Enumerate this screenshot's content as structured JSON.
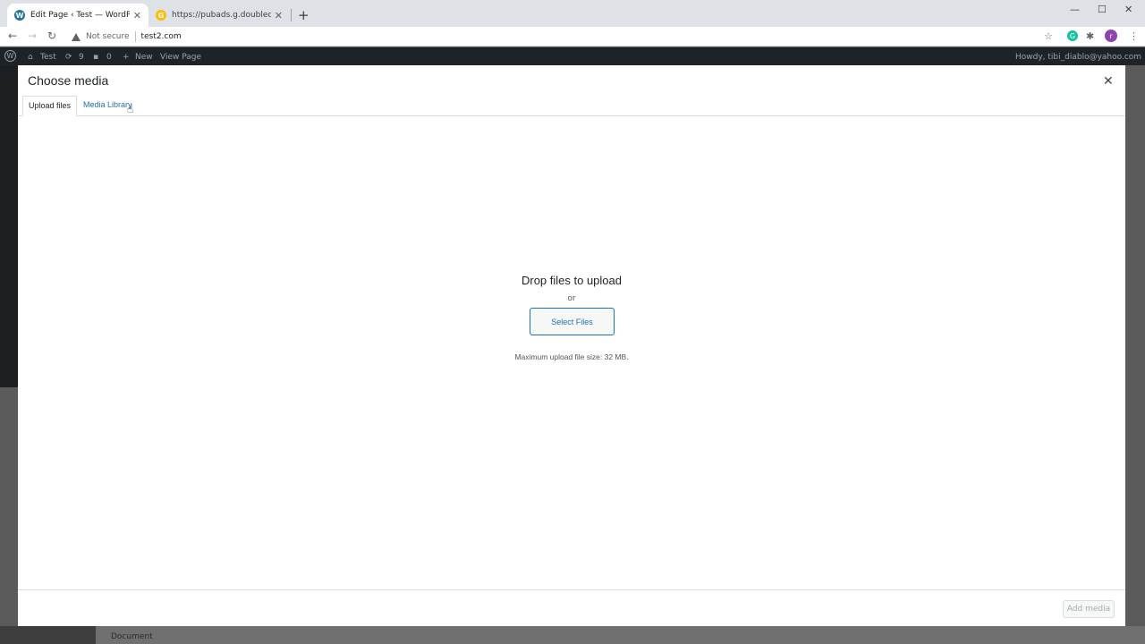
{
  "browser": {
    "tabs": [
      {
        "title": "Edit Page ‹ Test — WordPress",
        "favicon": "wordpress-icon"
      },
      {
        "title": "https://pubads.g.doubleclick.net/",
        "favicon": "google-icon"
      }
    ],
    "security_label": "Not secure",
    "url": "test2.com",
    "profile_initial": "r"
  },
  "adminbar": {
    "site_name": "Test",
    "updates_count": "9",
    "comments_count": "0",
    "new_label": "New",
    "view_page_label": "View Page",
    "howdy": "Howdy, tibi_diablo@yahoo.com"
  },
  "modal": {
    "title": "Choose media",
    "tabs": [
      {
        "label": "Upload files",
        "active": true
      },
      {
        "label": "Media Library",
        "active": false
      }
    ],
    "drop_title": "Drop files to upload",
    "or_label": "or",
    "select_files_label": "Select Files",
    "max_size_text": "Maximum upload file size: 32 MB.",
    "add_media_label": "Add media"
  },
  "background": {
    "document_label": "Document"
  }
}
